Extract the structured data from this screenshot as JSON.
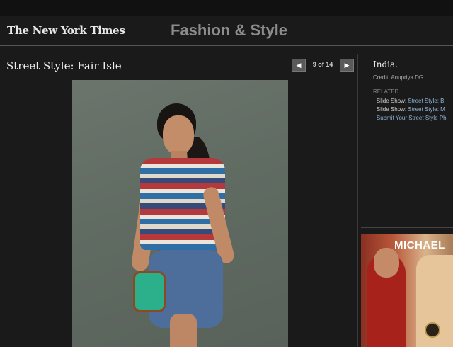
{
  "masthead": {
    "logo_text": "The New York Times",
    "section_title": "Fashion & Style"
  },
  "slideshow": {
    "title": "Street Style: Fair Isle",
    "counter": "9 of 14",
    "prev_icon": "◀",
    "next_icon": "▶",
    "photo_alt": "Woman in Fair Isle patterned top, denim shorts and green bag against gray wall"
  },
  "sidebar": {
    "caption": "India.",
    "credit": "Credit: Anupriya DG",
    "related_heading": "RELATED",
    "related": [
      {
        "prefix": "Slide Show: ",
        "link": "Street Style: B"
      },
      {
        "prefix": "Slide Show: ",
        "link": "Street Style: M"
      },
      {
        "prefix": "",
        "link": "Submit Your Street Style Ph"
      }
    ]
  },
  "ad": {
    "brand": "MICHAEL"
  },
  "colors": {
    "background": "#1a1a1a",
    "link": "#8fb3d9",
    "section_title": "#8c8c8c"
  }
}
